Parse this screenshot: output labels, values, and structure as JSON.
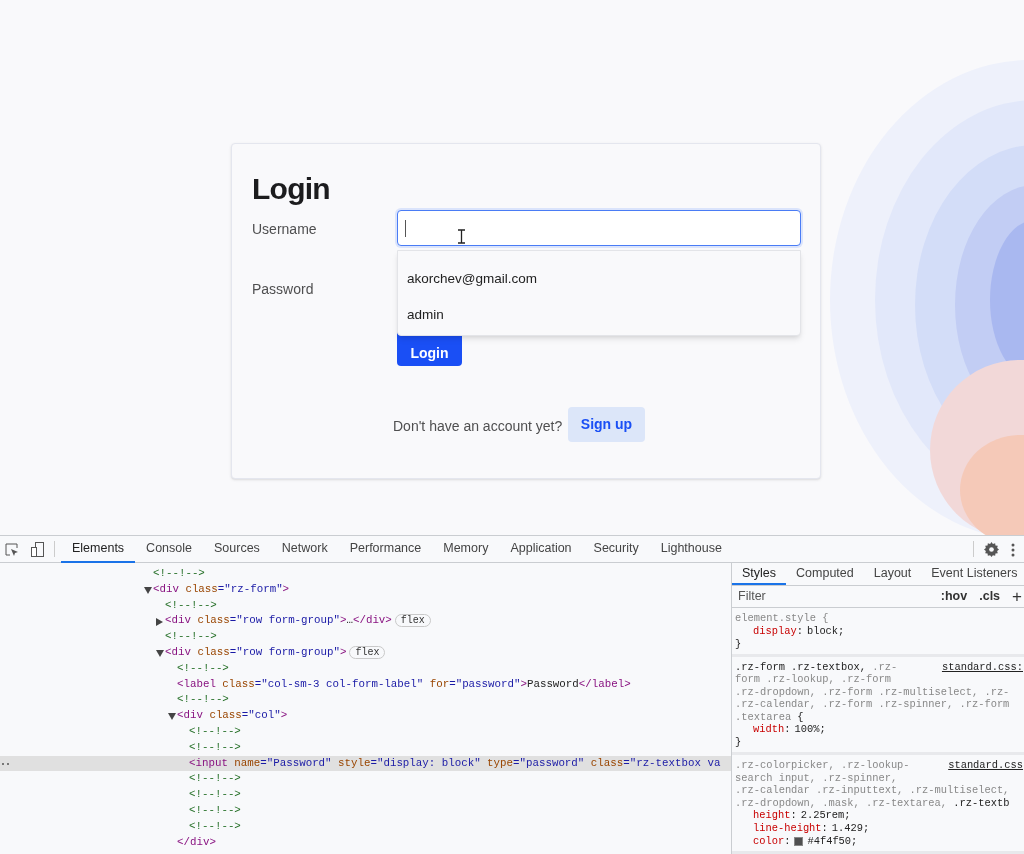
{
  "page": {
    "login_card": {
      "title": "Login",
      "username_label": "Username",
      "password_label": "Password",
      "autocomplete": [
        {
          "text": "akorchev@gmail.com"
        },
        {
          "text": "admin"
        }
      ],
      "login_button": "Login",
      "signup_prompt": "Don't have an account yet?",
      "signup_button": "Sign up"
    }
  },
  "devtools": {
    "tabs": [
      {
        "label": "Elements",
        "selected": true
      },
      {
        "label": "Console",
        "selected": false
      },
      {
        "label": "Sources",
        "selected": false
      },
      {
        "label": "Network",
        "selected": false
      },
      {
        "label": "Performance",
        "selected": false
      },
      {
        "label": "Memory",
        "selected": false
      },
      {
        "label": "Application",
        "selected": false
      },
      {
        "label": "Security",
        "selected": false
      },
      {
        "label": "Lighthouse",
        "selected": false
      }
    ],
    "dom_tree": [
      {
        "selected": false,
        "tokens": [
          {
            "kind": "comment",
            "text": "<!--!-->"
          }
        ]
      },
      {
        "expanded": true,
        "selected": false,
        "tokens": [
          {
            "kind": "tag",
            "text": "<div"
          },
          {
            "kind": "attr",
            "text": " class"
          },
          {
            "kind": "value",
            "text": "=\"rz-form\""
          },
          {
            "kind": "tag",
            "text": ">"
          }
        ],
        "children": [
          {
            "selected": false,
            "tokens": [
              {
                "kind": "comment",
                "text": "<!--!-->"
              }
            ]
          },
          {
            "expanded": false,
            "selected": false,
            "tokens": [
              {
                "kind": "tag",
                "text": "<div"
              },
              {
                "kind": "attr",
                "text": " class"
              },
              {
                "kind": "value",
                "text": "=\"row form-group\""
              },
              {
                "kind": "tag",
                "text": ">"
              },
              {
                "kind": "text",
                "text": "…"
              },
              {
                "kind": "tag",
                "text": "</div>"
              },
              {
                "kind": "badge",
                "text": "flex"
              }
            ]
          },
          {
            "selected": false,
            "tokens": [
              {
                "kind": "comment",
                "text": "<!--!-->"
              }
            ]
          },
          {
            "expanded": true,
            "selected": false,
            "tokens": [
              {
                "kind": "tag",
                "text": "<div"
              },
              {
                "kind": "attr",
                "text": " class"
              },
              {
                "kind": "value",
                "text": "=\"row form-group\""
              },
              {
                "kind": "tag",
                "text": ">"
              },
              {
                "kind": "badge",
                "text": "flex"
              }
            ],
            "children": [
              {
                "selected": false,
                "tokens": [
                  {
                    "kind": "comment",
                    "text": "<!--!-->"
                  }
                ]
              },
              {
                "selected": false,
                "tokens": [
                  {
                    "kind": "tag",
                    "text": "<label"
                  },
                  {
                    "kind": "attr",
                    "text": " class"
                  },
                  {
                    "kind": "value",
                    "text": "=\"col-sm-3 col-form-label\""
                  },
                  {
                    "kind": "attr",
                    "text": " for"
                  },
                  {
                    "kind": "value",
                    "text": "=\"password\""
                  },
                  {
                    "kind": "tag",
                    "text": ">"
                  },
                  {
                    "kind": "text",
                    "text": "Password"
                  },
                  {
                    "kind": "tag",
                    "text": "</label>"
                  }
                ]
              },
              {
                "selected": false,
                "tokens": [
                  {
                    "kind": "comment",
                    "text": "<!--!-->"
                  }
                ]
              },
              {
                "expanded": true,
                "selected": false,
                "closing": "</div>",
                "tokens": [
                  {
                    "kind": "tag",
                    "text": "<div"
                  },
                  {
                    "kind": "attr",
                    "text": " class"
                  },
                  {
                    "kind": "value",
                    "text": "=\"col\""
                  },
                  {
                    "kind": "tag",
                    "text": ">"
                  }
                ],
                "children": [
                  {
                    "selected": false,
                    "tokens": [
                      {
                        "kind": "comment",
                        "text": "<!--!-->"
                      }
                    ]
                  },
                  {
                    "selected": false,
                    "tokens": [
                      {
                        "kind": "comment",
                        "text": "<!--!-->"
                      }
                    ]
                  },
                  {
                    "selected": true,
                    "tokens": [
                      {
                        "kind": "tag",
                        "text": "<input"
                      },
                      {
                        "kind": "attr",
                        "text": " name"
                      },
                      {
                        "kind": "value",
                        "text": "=\"Password\""
                      },
                      {
                        "kind": "attr",
                        "text": " style"
                      },
                      {
                        "kind": "value",
                        "text": "=\"display: block\""
                      },
                      {
                        "kind": "attr",
                        "text": " type"
                      },
                      {
                        "kind": "value",
                        "text": "=\"password\""
                      },
                      {
                        "kind": "attr",
                        "text": " class"
                      },
                      {
                        "kind": "value",
                        "text": "=\"rz-textbox va"
                      }
                    ]
                  },
                  {
                    "selected": false,
                    "tokens": [
                      {
                        "kind": "comment",
                        "text": "<!--!-->"
                      }
                    ]
                  },
                  {
                    "selected": false,
                    "tokens": [
                      {
                        "kind": "comment",
                        "text": "<!--!-->"
                      }
                    ]
                  },
                  {
                    "selected": false,
                    "tokens": [
                      {
                        "kind": "comment",
                        "text": "<!--!-->"
                      }
                    ]
                  },
                  {
                    "selected": false,
                    "tokens": [
                      {
                        "kind": "comment",
                        "text": "<!--!-->"
                      }
                    ]
                  }
                ]
              }
            ]
          }
        ]
      }
    ],
    "sidebar_tabs": [
      {
        "label": "Styles",
        "selected": true
      },
      {
        "label": "Computed",
        "selected": false
      },
      {
        "label": "Layout",
        "selected": false
      },
      {
        "label": "Event Listeners",
        "selected": false
      }
    ],
    "filter": {
      "placeholder": "Filter",
      "hov": ":hov",
      "cls": ".cls",
      "add": "+"
    },
    "rules": [
      {
        "selector_lines": [
          [
            {
              "text": "element.style {",
              "matched": false
            }
          ]
        ],
        "properties": [
          {
            "name": "display",
            "separator": ":",
            "value": "block;"
          }
        ],
        "closing": "}"
      },
      {
        "source": "standard.css:",
        "selector_lines": [
          [
            {
              "text": ".rz-form .rz-textbox,",
              "matched": true
            },
            {
              "text": " .rz-",
              "matched": false
            }
          ],
          [
            {
              "text": "form .rz-lookup, .rz-form",
              "matched": false
            }
          ],
          [
            {
              "text": ".rz-dropdown, .rz-form .rz-multiselect, .rz-",
              "matched": false
            }
          ],
          [
            {
              "text": ".rz-calendar, .rz-form .rz-spinner, .rz-form",
              "matched": false
            }
          ],
          [
            {
              "text": ".textarea",
              "matched": false
            },
            {
              "text": " {",
              "matched": true
            }
          ]
        ],
        "properties": [
          {
            "name": "width",
            "separator": ":",
            "value": "100%;"
          }
        ],
        "closing": "}"
      },
      {
        "source": "standard.css",
        "selector_lines": [
          [
            {
              "text": ".rz-colorpicker, .rz-lookup-",
              "matched": false
            }
          ],
          [
            {
              "text": "search input, .rz-spinner,",
              "matched": false
            }
          ],
          [
            {
              "text": ".rz-calendar .rz-inputtext, .rz-multiselect,",
              "matched": false
            }
          ],
          [
            {
              "text": ".rz-dropdown, .mask, .rz-textarea,",
              "matched": false
            },
            {
              "text": " .rz-textb",
              "matched": true
            }
          ]
        ],
        "properties": [
          {
            "name": "height",
            "separator": ":",
            "value": "2.25rem;"
          },
          {
            "name": "line-height",
            "separator": ":",
            "value": "1.429;"
          },
          {
            "name": "color",
            "separator": ":",
            "value": "#4f4f50;",
            "kind": "color"
          }
        ]
      }
    ]
  }
}
